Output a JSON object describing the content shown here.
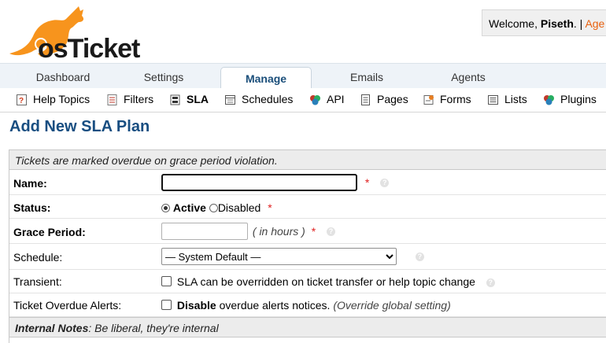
{
  "brand": {
    "logo_text": "osTicket",
    "accent": "#f7941d",
    "dark": "#1a1a1a"
  },
  "header": {
    "welcome_prefix": "Welcome, ",
    "username": "Piseth",
    "welcome_suffix": ". | ",
    "agent_link": "Age"
  },
  "tabs": [
    {
      "label": "Dashboard",
      "active": false
    },
    {
      "label": "Settings",
      "active": false
    },
    {
      "label": "Manage",
      "active": true
    },
    {
      "label": "Emails",
      "active": false
    },
    {
      "label": "Agents",
      "active": false
    }
  ],
  "subnav": [
    {
      "label": "Help Topics",
      "icon": "help-topics-icon"
    },
    {
      "label": "Filters",
      "icon": "filters-icon"
    },
    {
      "label": "SLA",
      "icon": "sla-icon",
      "active": true
    },
    {
      "label": "Schedules",
      "icon": "schedules-icon"
    },
    {
      "label": "API",
      "icon": "api-icon"
    },
    {
      "label": "Pages",
      "icon": "pages-icon"
    },
    {
      "label": "Forms",
      "icon": "forms-icon"
    },
    {
      "label": "Lists",
      "icon": "lists-icon"
    },
    {
      "label": "Plugins",
      "icon": "plugins-icon"
    }
  ],
  "page": {
    "title": "Add New SLA Plan"
  },
  "form": {
    "intro": "Tickets are marked overdue on grace period violation.",
    "name": {
      "label": "Name:",
      "value": "",
      "required": "*"
    },
    "status": {
      "label": "Status:",
      "options": [
        {
          "label": "Active",
          "selected": true
        },
        {
          "label": "Disabled",
          "selected": false
        }
      ],
      "required": "*"
    },
    "grace": {
      "label": "Grace Period:",
      "value": "",
      "hint": "( in hours )",
      "required": "*"
    },
    "schedule": {
      "label": "Schedule:",
      "selected": "— System Default —"
    },
    "transient": {
      "label": "Transient:",
      "checkbox_text": "SLA can be overridden on ticket transfer or help topic change",
      "checked": false
    },
    "alerts": {
      "label": "Ticket Overdue Alerts:",
      "bold": "Disable",
      "text": " overdue alerts notices.",
      "note": "(Override global setting)",
      "checked": false
    },
    "internal_notes": {
      "title": "Internal Notes",
      "text": ": Be liberal, they're internal"
    }
  }
}
